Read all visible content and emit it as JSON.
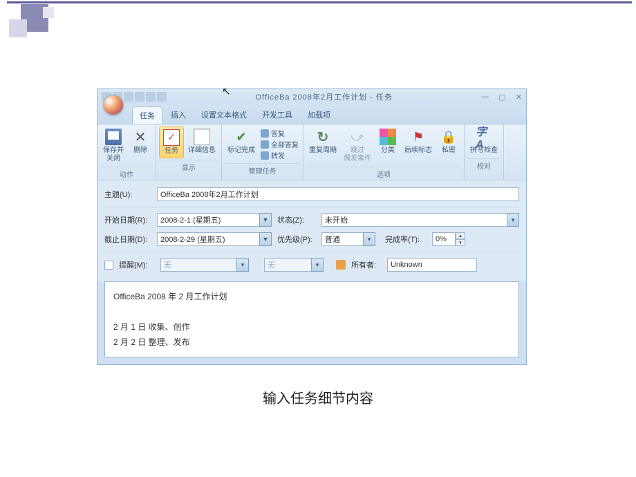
{
  "page_caption": "输入任务细节内容",
  "title_bar": {
    "title": "OfficeBa 2008年2月工作计划 - 任务"
  },
  "tabs": [
    {
      "label": "任务",
      "active": true
    },
    {
      "label": "插入"
    },
    {
      "label": "设置文本格式"
    },
    {
      "label": "开发工具"
    },
    {
      "label": "加载项"
    }
  ],
  "ribbon": {
    "groups": [
      {
        "name": "动作",
        "items": [
          {
            "kind": "button",
            "label": "保存并\n关闭",
            "icon": "save"
          },
          {
            "kind": "button",
            "label": "删除",
            "icon": "del"
          }
        ]
      },
      {
        "name": "显示",
        "items": [
          {
            "kind": "button",
            "label": "任务",
            "icon": "task",
            "active": true
          },
          {
            "kind": "button",
            "label": "详细信息",
            "icon": "detail"
          }
        ]
      },
      {
        "name": "管理任务",
        "items": [
          {
            "kind": "button",
            "label": "标记完成",
            "icon": "check"
          },
          {
            "kind": "small-list",
            "items": [
              "答复",
              "全部答复",
              "转发"
            ]
          }
        ]
      },
      {
        "name": "选项",
        "items": [
          {
            "kind": "button",
            "label": "重复周期",
            "icon": "repeat"
          },
          {
            "kind": "button",
            "label": "跳过\n偶发事件",
            "icon": "skip",
            "disabled": true
          },
          {
            "kind": "button",
            "label": "分类",
            "icon": "cat"
          },
          {
            "kind": "button",
            "label": "后续标志",
            "icon": "flag"
          },
          {
            "kind": "button",
            "label": "私密",
            "icon": "lock"
          }
        ]
      },
      {
        "name": "校对",
        "items": [
          {
            "kind": "button",
            "label": "拼写检查",
            "icon": "spell"
          }
        ]
      }
    ]
  },
  "form": {
    "subject_label": "主题(U):",
    "subject_value": "OfficeBa 2008年2月工作计划",
    "start_label": "开始日期(R):",
    "start_value": "2008-2-1 (星期五)",
    "due_label": "截止日期(D):",
    "due_value": "2008-2-29 (星期五)",
    "status_label": "状态(Z):",
    "status_value": "未开始",
    "priority_label": "优先级(P):",
    "priority_value": "普通",
    "completion_label": "完成率(T):",
    "completion_value": "0%",
    "reminder_label": "提醒(M):",
    "reminder_date": "无",
    "reminder_time": "无",
    "owner_label": "所有者:",
    "owner_value": "Unknown"
  },
  "body": {
    "line1": "OfficeBa 2008 年 2 月工作计划",
    "line2": "2 月 1 日    收集、创作",
    "line3": "2 月 2 日    整理、发布"
  }
}
